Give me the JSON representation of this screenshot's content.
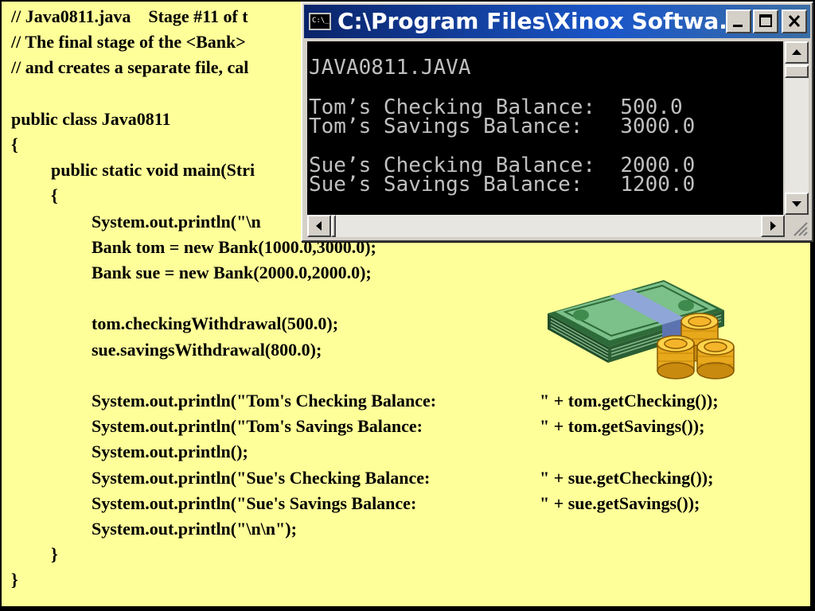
{
  "code": {
    "lines": [
      {
        "indent": 0,
        "text": "// Java0811.java    Stage #11 of t"
      },
      {
        "indent": 0,
        "text": "// The final stage of the <Bank>"
      },
      {
        "indent": 0,
        "text": "// and creates a separate file, cal"
      },
      {
        "indent": 0,
        "text": ""
      },
      {
        "indent": 0,
        "text": "public class Java0811"
      },
      {
        "indent": 0,
        "text": "{"
      },
      {
        "indent": 1,
        "text": "public static void main(Stri"
      },
      {
        "indent": 1,
        "text": "{"
      },
      {
        "indent": 2,
        "text": "System.out.println(\"\\n"
      },
      {
        "indent": 2,
        "text": "Bank tom = new Bank(1000.0,3000.0);"
      },
      {
        "indent": 2,
        "text": "Bank sue = new Bank(2000.0,2000.0);"
      },
      {
        "indent": 0,
        "text": ""
      },
      {
        "indent": 2,
        "text": "tom.checkingWithdrawal(500.0);"
      },
      {
        "indent": 2,
        "text": "sue.savingsWithdrawal(800.0);"
      },
      {
        "indent": 0,
        "text": ""
      },
      {
        "indent": 2,
        "text": "System.out.println(\"Tom's Checking Balance:",
        "tail": "\" + tom.getChecking());"
      },
      {
        "indent": 2,
        "text": "System.out.println(\"Tom's Savings Balance:",
        "tail": "\" + tom.getSavings());"
      },
      {
        "indent": 2,
        "text": "System.out.println();"
      },
      {
        "indent": 2,
        "text": "System.out.println(\"Sue's Checking Balance:",
        "tail": "\" + sue.getChecking());"
      },
      {
        "indent": 2,
        "text": "System.out.println(\"Sue's Savings Balance:",
        "tail": "\" + sue.getSavings());"
      },
      {
        "indent": 2,
        "text": "System.out.println(\"\\n\\n\");"
      },
      {
        "indent": 1,
        "text": "}"
      },
      {
        "indent": 0,
        "text": "}"
      }
    ]
  },
  "console": {
    "title": "C:\\Program Files\\Xinox Softwa...",
    "icon_label": "C:\\_",
    "output": [
      "JAVA0811.JAVA",
      "",
      "Tom’s Checking Balance:  500.0",
      "Tom’s Savings Balance:   3000.0",
      "",
      "Sue’s Checking Balance:  2000.0",
      "Sue’s Savings Balance:   1200.0"
    ],
    "icons": {
      "app": "console-icon",
      "minimize": "minimize-icon",
      "maximize": "maximize-icon",
      "close": "close-icon"
    }
  },
  "colors": {
    "slide_background": "#ffff99",
    "titlebar": "#0a246a",
    "console_text": "#c0c0c0"
  },
  "decoration": {
    "clipart": "money-stack-coins"
  }
}
